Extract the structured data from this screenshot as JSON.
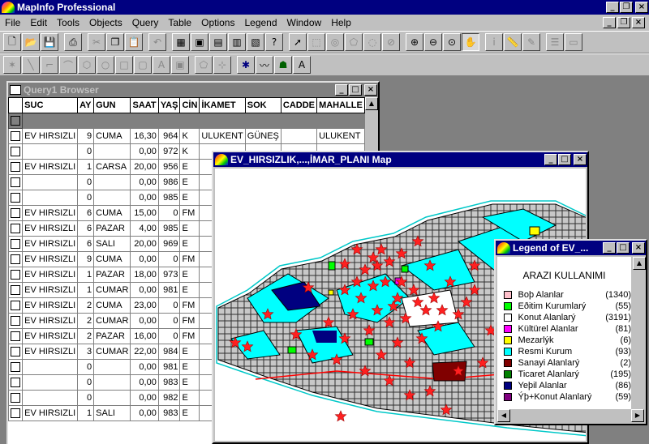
{
  "app": {
    "title": "MapInfo Professional"
  },
  "menu": [
    "File",
    "Edit",
    "Tools",
    "Objects",
    "Query",
    "Table",
    "Options",
    "Legend",
    "Window",
    "Help"
  ],
  "toolbar1": [
    "new",
    "open",
    "save",
    "print",
    "cut",
    "copy",
    "paste",
    "undo",
    "browser",
    "mapper",
    "graph",
    "layout",
    "redistrict",
    "help-pointer",
    "select",
    "marquee",
    "radius",
    "polygon-select",
    "boundary",
    "zoom-in",
    "zoom-out",
    "change-view",
    "grabber",
    "info",
    "ruler",
    "label",
    "drag-map",
    "layer-control"
  ],
  "toolbar2": [
    "symbol",
    "line",
    "polyline",
    "arc",
    "polygon",
    "ellipse",
    "rectangle",
    "text",
    "frame",
    "reshape",
    "add-node",
    "symbol-style",
    "line-style",
    "region-style",
    "text-style"
  ],
  "browser": {
    "title": "Query1 Browser",
    "columns": [
      "SUC",
      "AY",
      "GUN",
      "SAAT",
      "YAŞ",
      "CİN",
      "İKAMET",
      "SOK",
      "CADDE",
      "MAHALLE"
    ],
    "rows": [
      [
        "EV HIRSIZLI",
        "9",
        "CUMA",
        "16,30",
        "964",
        "K",
        "ULUKENT",
        "GÜNEŞ",
        "",
        "ULUKENT"
      ],
      [
        "",
        "0",
        "",
        "0,00",
        "972",
        "K",
        "",
        "",
        "",
        ""
      ],
      [
        "EV HIRSIZLI",
        "1",
        "CARSA",
        "20,00",
        "956",
        "E",
        "",
        "",
        "",
        ""
      ],
      [
        "",
        "0",
        "",
        "0,00",
        "986",
        "E",
        "",
        "",
        "",
        ""
      ],
      [
        "",
        "0",
        "",
        "0,00",
        "985",
        "E",
        "",
        "",
        "",
        ""
      ],
      [
        "EV HIRSIZLI",
        "6",
        "CUMA",
        "15,00",
        "0",
        "FM",
        "",
        "",
        "",
        ""
      ],
      [
        "EV HIRSIZLI",
        "6",
        "PAZAR",
        "4,00",
        "985",
        "E",
        "",
        "",
        "",
        ""
      ],
      [
        "EV HIRSIZLI",
        "6",
        "SALI",
        "20,00",
        "969",
        "E",
        "",
        "",
        "",
        ""
      ],
      [
        "EV HIRSIZLI",
        "9",
        "CUMA",
        "0,00",
        "0",
        "FM",
        "",
        "",
        "",
        ""
      ],
      [
        "EV HIRSIZLI",
        "1",
        "PAZAR",
        "18,00",
        "973",
        "E",
        "",
        "",
        "",
        ""
      ],
      [
        "EV HIRSIZLI",
        "1",
        "CUMAR",
        "0,00",
        "981",
        "E",
        "",
        "",
        "",
        ""
      ],
      [
        "EV HIRSIZLI",
        "2",
        "CUMA",
        "23,00",
        "0",
        "FM",
        "",
        "",
        "",
        ""
      ],
      [
        "EV HIRSIZLI",
        "2",
        "CUMAR",
        "0,00",
        "0",
        "FM",
        "",
        "",
        "",
        ""
      ],
      [
        "EV HIRSIZLI",
        "2",
        "PAZAR",
        "16,00",
        "0",
        "FM",
        "",
        "",
        "",
        ""
      ],
      [
        "EV HIRSIZLI",
        "3",
        "CUMAR",
        "22,00",
        "984",
        "E",
        "",
        "",
        "",
        ""
      ],
      [
        "",
        "0",
        "",
        "0,00",
        "981",
        "E",
        "",
        "",
        "",
        ""
      ],
      [
        "",
        "0",
        "",
        "0,00",
        "983",
        "E",
        "",
        "",
        "",
        ""
      ],
      [
        "",
        "0",
        "",
        "0,00",
        "982",
        "E",
        "",
        "",
        "",
        ""
      ],
      [
        "EV HIRSIZLI",
        "1",
        "SALI",
        "0,00",
        "983",
        "E",
        "",
        "",
        "",
        ""
      ]
    ]
  },
  "map": {
    "title": "EV_HIRSIZLIK,...,İMAR_PLANI Map"
  },
  "legend": {
    "title": "Legend of EV_...",
    "heading": "ARAZI KULLANIMI",
    "items": [
      {
        "label": "Boþ Alanlar",
        "count": "(1340)",
        "color": "#ffc0cb"
      },
      {
        "label": "Eðitim Kurumlarý",
        "count": "(55)",
        "color": "#00ff00"
      },
      {
        "label": "Konut Alanlarý",
        "count": "(3191)",
        "color": "#ffffff"
      },
      {
        "label": "Kültürel Alanlar",
        "count": "(81)",
        "color": "#ff00ff"
      },
      {
        "label": "Mezarlýk",
        "count": "(6)",
        "color": "#ffff00"
      },
      {
        "label": "Resmi Kurum",
        "count": "(93)",
        "color": "#00ffff"
      },
      {
        "label": "Sanayi Alanlarý",
        "count": "(2)",
        "color": "#800000"
      },
      {
        "label": "Ticaret Alanlarý",
        "count": "(195)",
        "color": "#008000"
      },
      {
        "label": "Yeþil Alanlar",
        "count": "(86)",
        "color": "#000080"
      },
      {
        "label": "Ýþ+Konut Alanlarý",
        "count": "(59)",
        "color": "#800080"
      }
    ]
  }
}
